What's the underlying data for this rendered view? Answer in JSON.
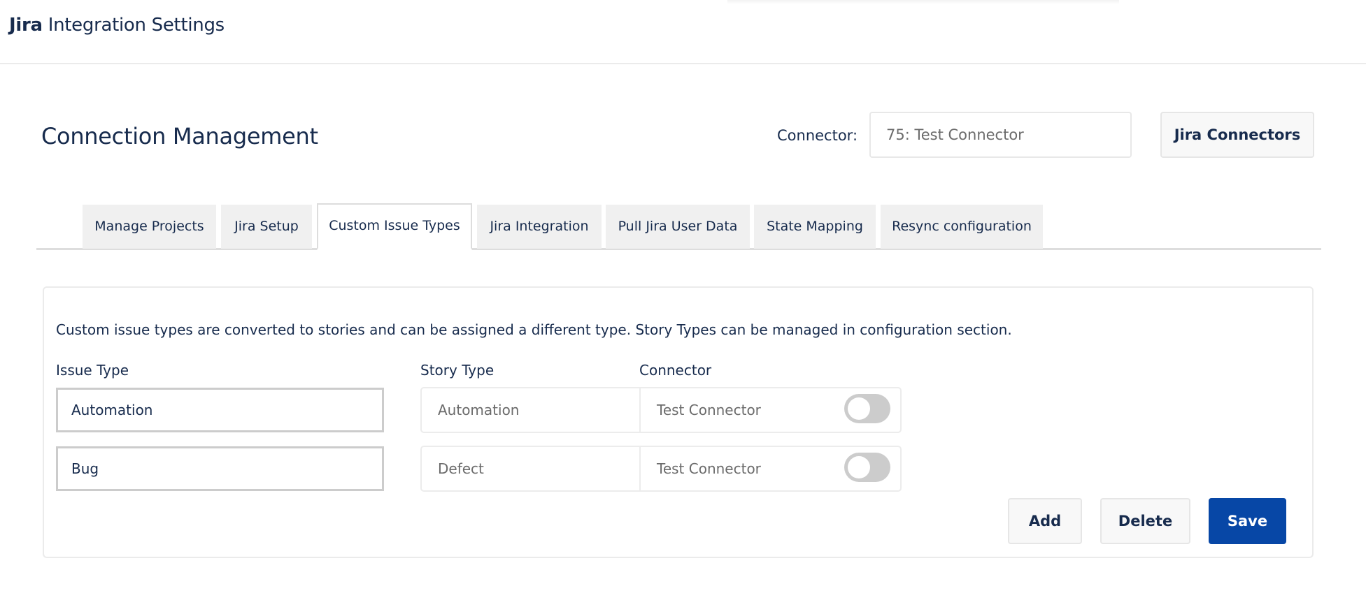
{
  "header": {
    "brand": "Jira",
    "title_rest": " Integration Settings"
  },
  "page": {
    "title": "Connection Management",
    "connector_label": "Connector:",
    "connector_value": "75: Test Connector",
    "jira_connectors_button": "Jira Connectors"
  },
  "tabs": [
    {
      "label": "Manage Projects",
      "active": false
    },
    {
      "label": "Jira Setup",
      "active": false
    },
    {
      "label": "Custom Issue Types",
      "active": true
    },
    {
      "label": "Jira Integration",
      "active": false
    },
    {
      "label": "Pull Jira User Data",
      "active": false
    },
    {
      "label": "State Mapping",
      "active": false
    },
    {
      "label": "Resync configuration",
      "active": false
    }
  ],
  "custom_issue_types": {
    "description": "Custom issue types are converted to stories and can be assigned a different type. Story Types can be managed in configuration section.",
    "columns": {
      "issue_type": "Issue Type",
      "story_type": "Story Type",
      "connector": "Connector"
    },
    "rows": [
      {
        "issue_type": "Automation",
        "story_type": "Automation",
        "connector": "Test Connector",
        "enabled": false
      },
      {
        "issue_type": "Bug",
        "story_type": "Defect",
        "connector": "Test Connector",
        "enabled": false
      }
    ],
    "buttons": {
      "add": "Add",
      "delete": "Delete",
      "save": "Save"
    }
  },
  "colors": {
    "primary": "#0747a6",
    "text": "#172b4d",
    "tab_inactive_bg": "#f0f0f0",
    "toggle_off": "#cccccc"
  }
}
